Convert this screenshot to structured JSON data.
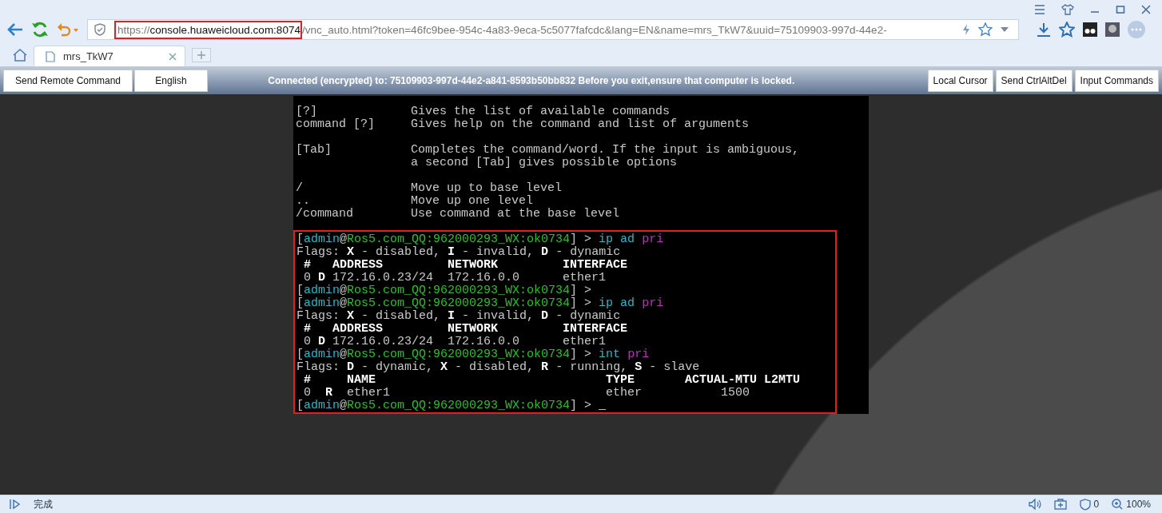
{
  "browser": {
    "address": {
      "scheme": "https://",
      "host": "console.huaweicloud.com:8074",
      "rest": "/vnc_auto.html?token=46fc9bee-954c-4a83-9eca-5c5077fafcdc&lang=EN&name=mrs_TkW7&uuid=75109903-997d-44e2-",
      "highlighted": true
    },
    "tabs": [
      {
        "title": "mrs_TkW7",
        "selected": true
      }
    ]
  },
  "toolbar": {
    "left_buttons": [
      "Send Remote Command",
      "English"
    ],
    "status": "Connected (encrypted) to: 75109903-997d-44e2-a841-8593b50bb832 Before you exit,ensure that computer is locked.",
    "right_buttons": [
      "Local Cursor",
      "Send CtrlAltDel",
      "Input Commands"
    ]
  },
  "terminal": {
    "help_groups": [
      [
        "[?]             Gives the list of available commands",
        "command [?]     Gives help on the command and list of arguments"
      ],
      [
        "[Tab]           Completes the command/word. If the input is ambiguous,",
        "                a second [Tab] gives possible options"
      ],
      [
        "/               Move up to base level",
        "..              Move up one level",
        "/command        Use command at the base level"
      ]
    ],
    "session": {
      "highlighted": true,
      "lines": [
        [
          {
            "kind": "text",
            "text": "["
          },
          {
            "kind": "user",
            "text": "admin"
          },
          {
            "kind": "text",
            "text": "@"
          },
          {
            "kind": "host",
            "text": "Ros5.com_QQ:962000293_WX:ok0734"
          },
          {
            "kind": "text",
            "text": "] > "
          },
          {
            "kind": "cmd",
            "text": "ip ad "
          },
          {
            "kind": "arg",
            "text": "pri"
          }
        ],
        [
          {
            "kind": "text",
            "text": "Flags: "
          },
          {
            "kind": "bold",
            "text": "X"
          },
          {
            "kind": "text",
            "text": " - disabled, "
          },
          {
            "kind": "bold",
            "text": "I"
          },
          {
            "kind": "text",
            "text": " - invalid, "
          },
          {
            "kind": "bold",
            "text": "D"
          },
          {
            "kind": "text",
            "text": " - dynamic"
          }
        ],
        [
          {
            "kind": "bold",
            "text": " #   ADDRESS         NETWORK         INTERFACE"
          }
        ],
        [
          {
            "kind": "text",
            "text": " 0 "
          },
          {
            "kind": "bold",
            "text": "D"
          },
          {
            "kind": "text",
            "text": " 172.16.0.23/24  172.16.0.0      ether1"
          }
        ],
        [
          {
            "kind": "text",
            "text": "["
          },
          {
            "kind": "user",
            "text": "admin"
          },
          {
            "kind": "text",
            "text": "@"
          },
          {
            "kind": "host",
            "text": "Ros5.com_QQ:962000293_WX:ok0734"
          },
          {
            "kind": "text",
            "text": "] >"
          }
        ],
        [
          {
            "kind": "text",
            "text": "["
          },
          {
            "kind": "user",
            "text": "admin"
          },
          {
            "kind": "text",
            "text": "@"
          },
          {
            "kind": "host",
            "text": "Ros5.com_QQ:962000293_WX:ok0734"
          },
          {
            "kind": "text",
            "text": "] > "
          },
          {
            "kind": "cmd",
            "text": "ip ad "
          },
          {
            "kind": "arg",
            "text": "pri"
          }
        ],
        [
          {
            "kind": "text",
            "text": "Flags: "
          },
          {
            "kind": "bold",
            "text": "X"
          },
          {
            "kind": "text",
            "text": " - disabled, "
          },
          {
            "kind": "bold",
            "text": "I"
          },
          {
            "kind": "text",
            "text": " - invalid, "
          },
          {
            "kind": "bold",
            "text": "D"
          },
          {
            "kind": "text",
            "text": " - dynamic"
          }
        ],
        [
          {
            "kind": "bold",
            "text": " #   ADDRESS         NETWORK         INTERFACE"
          }
        ],
        [
          {
            "kind": "text",
            "text": " 0 "
          },
          {
            "kind": "bold",
            "text": "D"
          },
          {
            "kind": "text",
            "text": " 172.16.0.23/24  172.16.0.0      ether1"
          }
        ],
        [
          {
            "kind": "text",
            "text": "["
          },
          {
            "kind": "user",
            "text": "admin"
          },
          {
            "kind": "text",
            "text": "@"
          },
          {
            "kind": "host",
            "text": "Ros5.com_QQ:962000293_WX:ok0734"
          },
          {
            "kind": "text",
            "text": "] > "
          },
          {
            "kind": "cmd",
            "text": "int "
          },
          {
            "kind": "arg",
            "text": "pri"
          }
        ],
        [
          {
            "kind": "text",
            "text": "Flags: "
          },
          {
            "kind": "bold",
            "text": "D"
          },
          {
            "kind": "text",
            "text": " - dynamic, "
          },
          {
            "kind": "bold",
            "text": "X"
          },
          {
            "kind": "text",
            "text": " - disabled, "
          },
          {
            "kind": "bold",
            "text": "R"
          },
          {
            "kind": "text",
            "text": " - running, "
          },
          {
            "kind": "bold",
            "text": "S"
          },
          {
            "kind": "text",
            "text": " - slave"
          }
        ],
        [
          {
            "kind": "bold",
            "text": " #     NAME                                TYPE       ACTUAL-MTU L2MTU"
          }
        ],
        [
          {
            "kind": "text",
            "text": " 0  "
          },
          {
            "kind": "bold",
            "text": "R"
          },
          {
            "kind": "text",
            "text": "  ether1                              ether           1500"
          }
        ],
        [
          {
            "kind": "text",
            "text": "["
          },
          {
            "kind": "user",
            "text": "admin"
          },
          {
            "kind": "text",
            "text": "@"
          },
          {
            "kind": "host",
            "text": "Ros5.com_QQ:962000293_WX:ok0734"
          },
          {
            "kind": "text",
            "text": "] > "
          },
          {
            "kind": "cursor",
            "text": "_"
          }
        ]
      ]
    }
  },
  "status_bar": {
    "text": "完成",
    "ad_count": "0",
    "zoom": "100%"
  }
}
